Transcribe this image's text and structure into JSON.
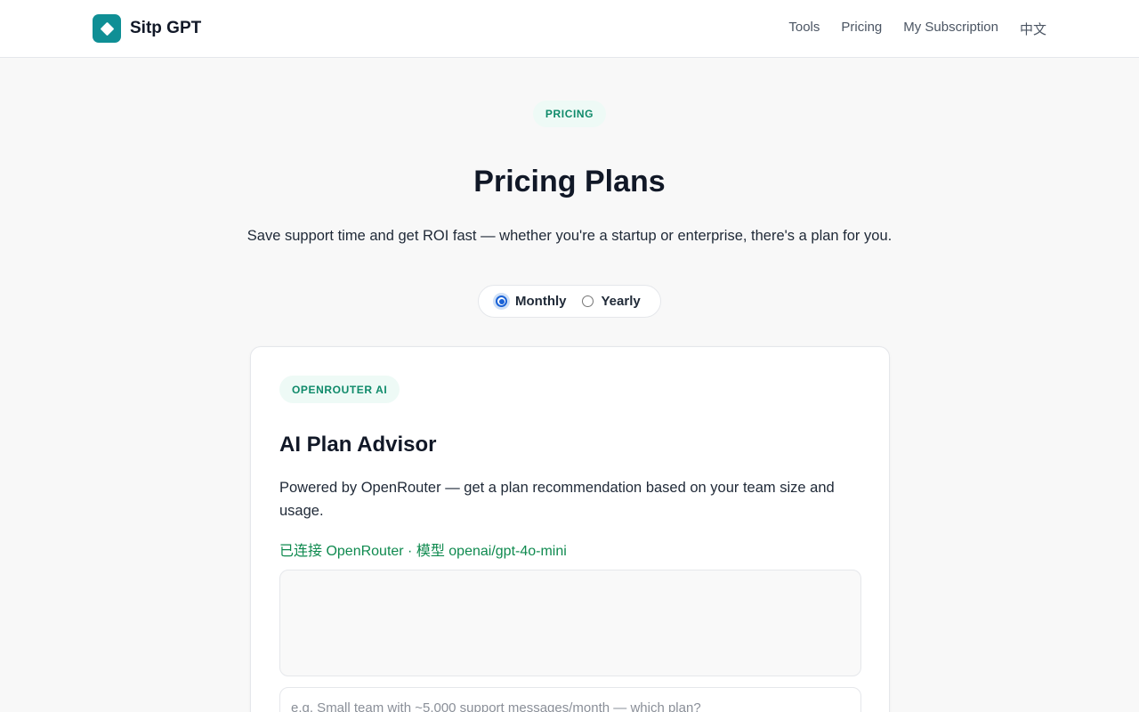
{
  "header": {
    "brand_name": "Sitp GPT",
    "nav": [
      "Tools",
      "Pricing",
      "My Subscription",
      "中文"
    ]
  },
  "hero": {
    "eyebrow": "PRICING",
    "title": "Pricing Plans",
    "subtitle": "Save support time and get ROI fast — whether you're a startup or enterprise, there's a plan for you."
  },
  "billing": {
    "options": [
      "Monthly",
      "Yearly"
    ],
    "selected": "Monthly"
  },
  "advisor": {
    "badge": "OPENROUTER AI",
    "title": "AI Plan Advisor",
    "description": "Powered by OpenRouter — get a plan recommendation based on your team size and usage.",
    "status": "已连接 OpenRouter · 模型 openai/gpt-4o-mini",
    "input_value": "",
    "input_placeholder": "e.g. Small team with ~5,000 support messages/month — which plan?"
  },
  "colors": {
    "brand": "#0f8f95",
    "accent_green": "#0f8a6a",
    "status_green": "#0f8a4f",
    "radio_blue": "#1a62d6"
  }
}
